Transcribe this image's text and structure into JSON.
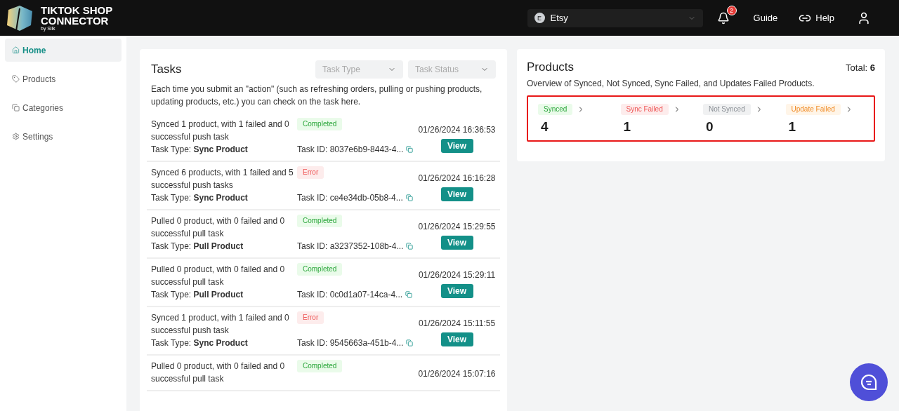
{
  "logo": {
    "line1": "TIKTOK SHOP",
    "line2": "CONNECTOR",
    "byline": "by Silk"
  },
  "header": {
    "store": {
      "initial": "E",
      "name": "Etsy"
    },
    "notification_count": "2",
    "guide": "Guide",
    "help": "Help"
  },
  "sidebar": {
    "items": [
      {
        "label": "Home",
        "selected": true
      },
      {
        "label": "Products",
        "selected": false
      },
      {
        "label": "Categories",
        "selected": false
      },
      {
        "label": "Settings",
        "selected": false
      }
    ]
  },
  "tasks": {
    "title": "Tasks",
    "filters": [
      {
        "placeholder": "Task Type"
      },
      {
        "placeholder": "Task Status"
      }
    ],
    "description": "Each time you submit an \"action\" (such as refreshing orders, pulling or pushing products, updating products, etc.) you can check on the task here.",
    "rows": [
      {
        "summary": "Synced 1 product, with 1 failed and 0 successful push task",
        "status": "Completed",
        "kind": "completed",
        "type_label": "Task Type:",
        "type": "Sync Product",
        "task_id": "Task ID: 8037e6b9-8443-4...",
        "date": "01/26/2024 16:36:53",
        "button": "View"
      },
      {
        "summary": "Synced 6 products, with 1 failed and 5 successful push tasks",
        "status": "Error",
        "kind": "error",
        "type_label": "Task Type:",
        "type": "Sync Product",
        "task_id": "Task ID: ce4e34db-05b8-4...",
        "date": "01/26/2024 16:16:28",
        "button": "View"
      },
      {
        "summary": "Pulled 0 product, with 0 failed and 0 successful pull task",
        "status": "Completed",
        "kind": "completed",
        "type_label": "Task Type:",
        "type": "Pull Product",
        "task_id": "Task ID: a3237352-108b-4...",
        "date": "01/26/2024 15:29:55",
        "button": "View"
      },
      {
        "summary": "Pulled 0 product, with 0 failed and 0 successful pull task",
        "status": "Completed",
        "kind": "completed",
        "type_label": "Task Type:",
        "type": "Pull Product",
        "task_id": "Task ID: 0c0d1a07-14ca-4...",
        "date": "01/26/2024 15:29:11",
        "button": "View"
      },
      {
        "summary": "Synced 1 product, with 1 failed and 0 successful push task",
        "status": "Error",
        "kind": "error",
        "type_label": "Task Type:",
        "type": "Sync Product",
        "task_id": "Task ID: 9545663a-451b-4...",
        "date": "01/26/2024 15:11:55",
        "button": "View"
      },
      {
        "summary": "Pulled 0 product, with 0 failed and 0 successful pull task",
        "status": "Completed",
        "kind": "completed",
        "date": "01/26/2024 15:07:16"
      }
    ]
  },
  "products": {
    "title": "Products",
    "total_label": "Total:",
    "total": "6",
    "description": "Overview of Synced, Not Synced, Sync Failed, and Updates Failed Products.",
    "stats": [
      {
        "label": "Synced",
        "kind": "green",
        "count": "4"
      },
      {
        "label": "Sync Failed",
        "kind": "red",
        "count": "1"
      },
      {
        "label": "Not Synced",
        "kind": "grey",
        "count": "0"
      },
      {
        "label": "Update Failed",
        "kind": "orange",
        "count": "1"
      }
    ]
  }
}
